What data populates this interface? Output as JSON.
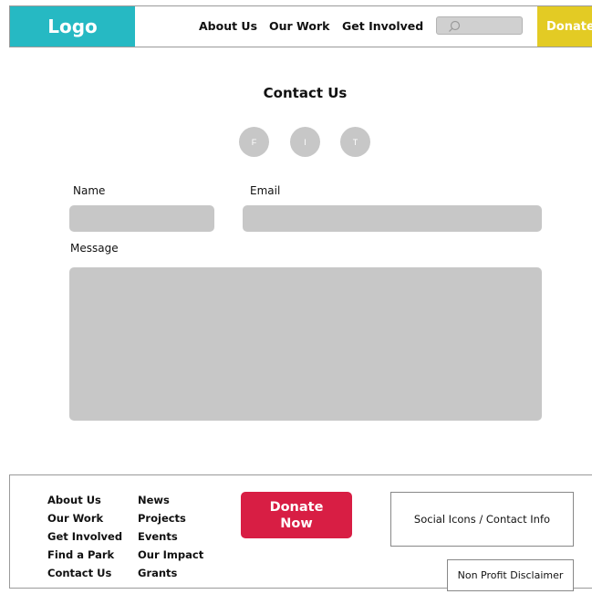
{
  "header": {
    "logo": "Logo",
    "nav": [
      "About Us",
      "Our Work",
      "Get Involved"
    ],
    "search_icon": "search-icon",
    "donate_label": "Donate"
  },
  "contact": {
    "title": "Contact Us",
    "social_icons": [
      "F",
      "I",
      "T"
    ],
    "name_label": "Name",
    "email_label": "Email",
    "message_label": "Message"
  },
  "footer": {
    "col1": [
      "About Us",
      "Our Work",
      "Get Involved",
      "Find a Park",
      "Contact Us"
    ],
    "col2": [
      "News",
      "Projects",
      "Events",
      "Our Impact",
      "Grants"
    ],
    "donate_line1": "Donate",
    "donate_line2": "Now",
    "social_box": "Social Icons / Contact Info",
    "disclaimer": "Non Profit Disclaimer"
  },
  "colors": {
    "logo_bg": "#26b9c3",
    "donate_top_bg": "#e3cb24",
    "donate_now_bg": "#d81e44",
    "placeholder_gray": "#c7c7c7"
  }
}
